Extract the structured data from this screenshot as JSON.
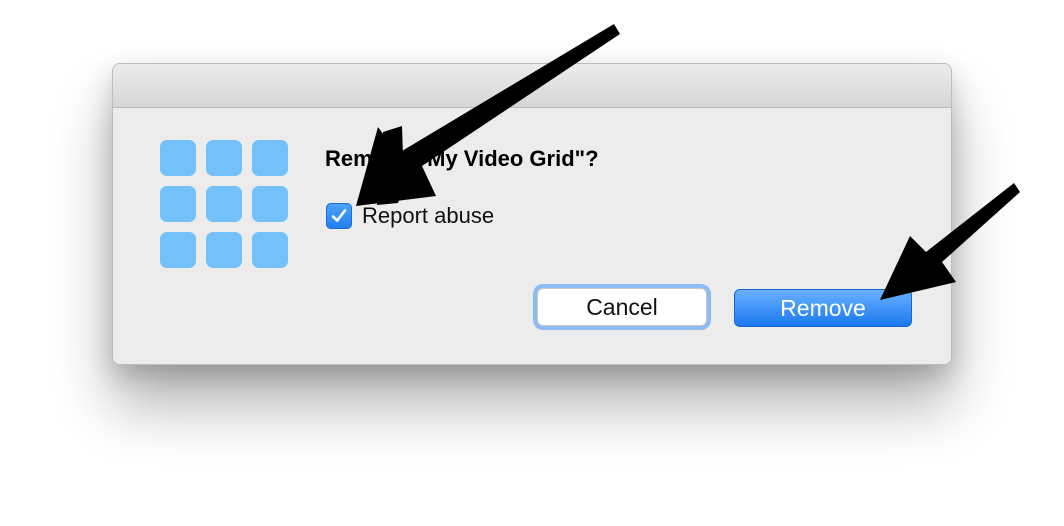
{
  "dialog": {
    "heading": "Remove \"My Video Grid\"?",
    "checkbox": {
      "label": "Report abuse",
      "checked": true
    },
    "buttons": {
      "cancel_label": "Cancel",
      "remove_label": "Remove"
    },
    "icon": "grid-app-icon"
  },
  "annotations": {
    "count": 3,
    "color": "#000000"
  },
  "colors": {
    "accent": "#1a78ef",
    "tile": "#72c1f8",
    "dialog_bg": "#ececec"
  }
}
